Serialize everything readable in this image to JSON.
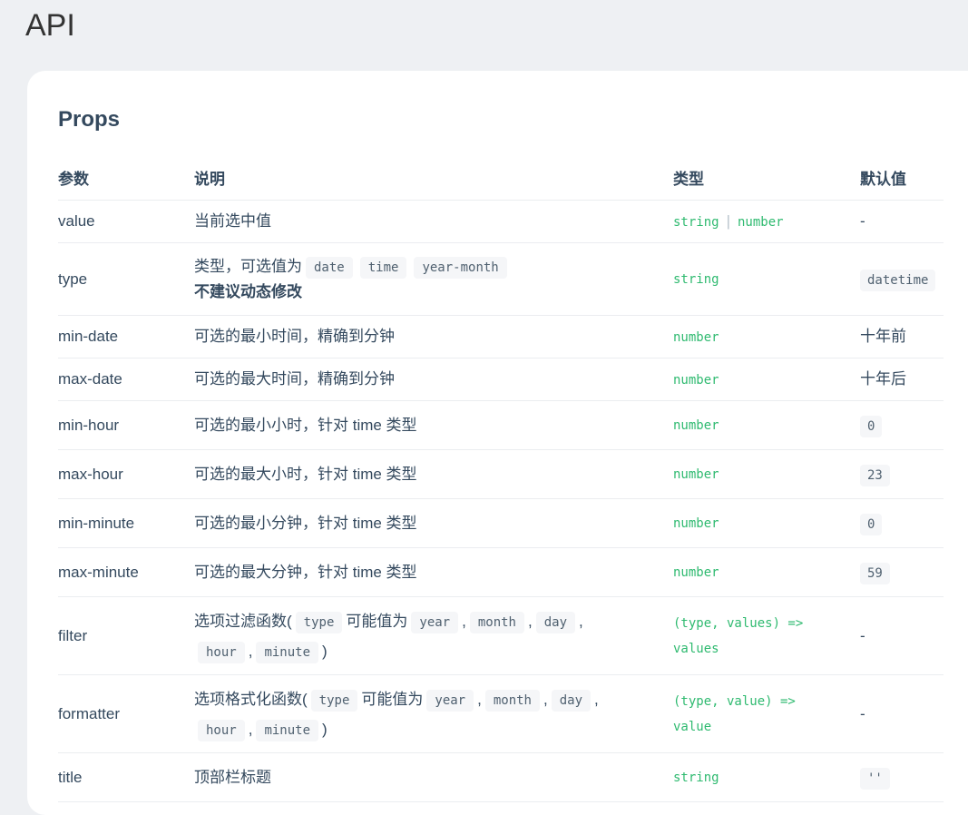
{
  "page": {
    "heading": "API",
    "section_title": "Props"
  },
  "table": {
    "headers": [
      "参数",
      "说明",
      "类型",
      "默认值"
    ],
    "rows": [
      {
        "param": "value",
        "desc": "当前选中值",
        "type_parts": [
          "string",
          "number"
        ],
        "default": "-",
        "default_code": false
      },
      {
        "param": "type",
        "desc_prefix": "类型，可选值为",
        "desc_codes": [
          "date",
          "time",
          "year-month"
        ],
        "desc_bold": "不建议动态修改",
        "type_parts": [
          "string"
        ],
        "default": "datetime",
        "default_code": true
      },
      {
        "param": "min-date",
        "desc": "可选的最小时间，精确到分钟",
        "type_parts": [
          "number"
        ],
        "default": "十年前",
        "default_code": false
      },
      {
        "param": "max-date",
        "desc": "可选的最大时间，精确到分钟",
        "type_parts": [
          "number"
        ],
        "default": "十年后",
        "default_code": false
      },
      {
        "param": "min-hour",
        "desc": "可选的最小小时，针对 time 类型",
        "type_parts": [
          "number"
        ],
        "default": "0",
        "default_code": true
      },
      {
        "param": "max-hour",
        "desc": "可选的最大小时，针对 time 类型",
        "type_parts": [
          "number"
        ],
        "default": "23",
        "default_code": true
      },
      {
        "param": "min-minute",
        "desc": "可选的最小分钟，针对 time 类型",
        "type_parts": [
          "number"
        ],
        "default": "0",
        "default_code": true
      },
      {
        "param": "max-minute",
        "desc": "可选的最大分钟，针对 time 类型",
        "type_parts": [
          "number"
        ],
        "default": "59",
        "default_code": true
      },
      {
        "param": "filter",
        "desc_prefix": "选项过滤函数(",
        "desc_arg": "type",
        "desc_mid": "可能值为",
        "desc_values": [
          "year",
          "month",
          "day",
          "hour",
          "minute"
        ],
        "desc_suffix": ")",
        "type_line1": "(type, values) =>",
        "type_line2": "values",
        "default": "-",
        "default_code": false
      },
      {
        "param": "formatter",
        "desc_prefix": "选项格式化函数(",
        "desc_arg": "type",
        "desc_mid": "可能值为",
        "desc_values": [
          "year",
          "month",
          "day",
          "hour",
          "minute"
        ],
        "desc_suffix": ")",
        "type_line1": "(type, value) =>",
        "type_line2": "value",
        "default": "-",
        "default_code": false
      },
      {
        "param": "title",
        "desc": "顶部栏标题",
        "type_parts": [
          "string"
        ],
        "default": "''",
        "default_code": true
      }
    ]
  }
}
